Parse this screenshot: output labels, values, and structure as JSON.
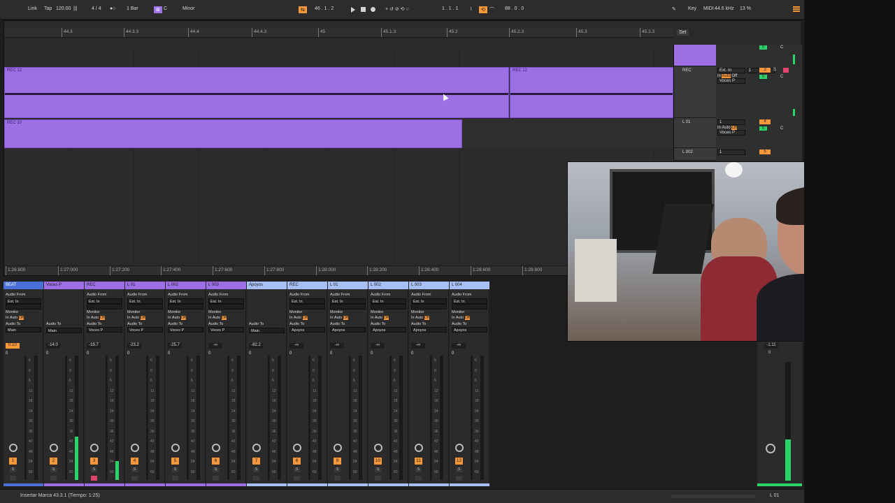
{
  "colors": {
    "accent_orange": "#f5973a",
    "clip_purple": "#9c6fe4",
    "meter_green": "#2bd46a",
    "record_red": "#e0466b",
    "blue_track": "#a7bff5"
  },
  "transport": {
    "link": "Link",
    "tap": "Tap",
    "tempo": "120.00",
    "signature": "4 / 4",
    "quantize": "1 Bar",
    "key": "C",
    "scale": "Minor",
    "position": "46 .  1 .  2",
    "loop_start": "1 .  1 .  1",
    "loop_length": "88 .  0 .  0",
    "key_label": "Key",
    "midi_label": "MIDI",
    "sample_rate": "44.6 kHz",
    "cpu": "13 %"
  },
  "arrangement": {
    "ruler": [
      "44.3",
      "44.3.3",
      "44.4",
      "44.4.3",
      "45",
      "45.1.3",
      "45.2",
      "45.2.3",
      "45.3",
      "45.3.3"
    ],
    "set_label": "Set",
    "time_ruler": [
      "1:26:800",
      "1:27:000",
      "1:27:200",
      "1:27:400",
      "1:27:600",
      "1:27:800",
      "1:28:000",
      "1:28:200",
      "1:28:400",
      "1:28:600",
      "1:28:800"
    ],
    "clips": [
      {
        "name": "REC 12"
      },
      {
        "name": "REC 12"
      },
      {
        "name": "REC 10"
      }
    ]
  },
  "track_headers": [
    {
      "name": "REC",
      "input": "Ext. In",
      "channel": "1",
      "monitor_in": "In",
      "monitor_auto": "Auto",
      "monitor_off": "Off",
      "output": "Voces P",
      "number": "3",
      "value": "0",
      "pan": "C"
    },
    {
      "name": "L 01",
      "input": "1",
      "channel": "",
      "monitor_in": "In",
      "monitor_auto": "Auto",
      "monitor_off": "Off",
      "output": "Voces P",
      "number": "4",
      "value": "0",
      "pan": "C"
    },
    {
      "name": "L 002",
      "input": "1",
      "channel": "",
      "monitor_in": "In",
      "monitor_auto": "Auto",
      "monitor_off": "Off",
      "output": "",
      "number": "5",
      "value": "",
      "pan": ""
    }
  ],
  "top_track_value": "0",
  "top_track_pan": "C",
  "mixer": {
    "labels": {
      "audio_from": "Audio From",
      "ext_in": "Ext. In",
      "monitor": "Monitor",
      "in": "In",
      "auto": "Auto",
      "off": "Off",
      "audio_to": "Audio To"
    },
    "strips": [
      {
        "title": "BEAT",
        "color": "#4a6fd6",
        "has_input": true,
        "output": "Main",
        "volume": "0.10",
        "vol_orange": true,
        "pan": "0",
        "number": "1",
        "meter": 0,
        "rec_on": false,
        "selbar": "#4a6fd6"
      },
      {
        "title": "Voces P",
        "color": "#9c6fe4",
        "has_input": false,
        "output": "Main",
        "volume": "-14.0",
        "vol_orange": false,
        "pan": "0",
        "number": "2",
        "meter": 0.35,
        "rec_on": false,
        "selbar": "#9c6fe4"
      },
      {
        "title": "REC",
        "color": "#9c6fe4",
        "has_input": true,
        "output": "Voces P",
        "volume": "-19.7",
        "vol_orange": false,
        "pan": "0",
        "number": "3",
        "meter": 0.15,
        "rec_on": true,
        "selbar": "#9c6fe4"
      },
      {
        "title": "L 01",
        "color": "#9c6fe4",
        "has_input": true,
        "output": "Voces P",
        "volume": "-23.2",
        "vol_orange": false,
        "pan": "0",
        "number": "4",
        "meter": 0,
        "rec_on": false,
        "selbar": "#9c6fe4"
      },
      {
        "title": "L 002",
        "color": "#9c6fe4",
        "has_input": true,
        "output": "Voces P",
        "volume": "-25.7",
        "vol_orange": false,
        "pan": "0",
        "number": "5",
        "meter": 0,
        "rec_on": false,
        "selbar": "#9c6fe4"
      },
      {
        "title": "L 003",
        "color": "#9c6fe4",
        "has_input": true,
        "output": "Voces P",
        "volume": "-∞",
        "vol_orange": false,
        "pan": "0",
        "number": "6",
        "meter": 0,
        "rec_on": false,
        "selbar": "#9c6fe4"
      },
      {
        "title": "Apoyos",
        "color": "#a7bff5",
        "has_input": false,
        "output": "Main",
        "volume": "-82.2",
        "vol_orange": false,
        "pan": "0",
        "number": "7",
        "meter": 0,
        "rec_on": false,
        "selbar": "#a7bff5"
      },
      {
        "title": "REC",
        "color": "#a7bff5",
        "has_input": true,
        "output": "Apoyos",
        "volume": "-∞",
        "vol_orange": false,
        "pan": "0",
        "number": "8",
        "meter": 0,
        "rec_on": false,
        "selbar": "#a7bff5"
      },
      {
        "title": "L 01",
        "color": "#a7bff5",
        "has_input": true,
        "output": "Apoyos",
        "volume": "-∞",
        "vol_orange": false,
        "pan": "0",
        "number": "9",
        "meter": 0,
        "rec_on": false,
        "selbar": "#a7bff5"
      },
      {
        "title": "L 002",
        "color": "#a7bff5",
        "has_input": true,
        "output": "Apoyos",
        "volume": "-∞",
        "vol_orange": false,
        "pan": "0",
        "number": "10",
        "meter": 0,
        "rec_on": false,
        "selbar": "#a7bff5"
      },
      {
        "title": "L 003",
        "color": "#a7bff5",
        "has_input": true,
        "output": "Apoyos",
        "volume": "-∞",
        "vol_orange": false,
        "pan": "0",
        "number": "11",
        "meter": 0,
        "rec_on": false,
        "selbar": "#a7bff5"
      },
      {
        "title": "L 004",
        "color": "#a7bff5",
        "has_input": true,
        "output": "Apoyos",
        "volume": "-∞",
        "vol_orange": false,
        "pan": "0",
        "number": "12",
        "meter": 0,
        "rec_on": false,
        "selbar": "#a7bff5"
      }
    ],
    "scale": [
      "6",
      "0",
      "6",
      "12",
      "18",
      "24",
      "30",
      "36",
      "42",
      "48",
      "54",
      "60"
    ],
    "master": {
      "volume": "-1.11",
      "pan": "0",
      "meter": 0.35
    }
  },
  "status": {
    "message": "Insertar Marca 43.3.1 (Tiempo: 1:25)",
    "track": "L 01"
  }
}
